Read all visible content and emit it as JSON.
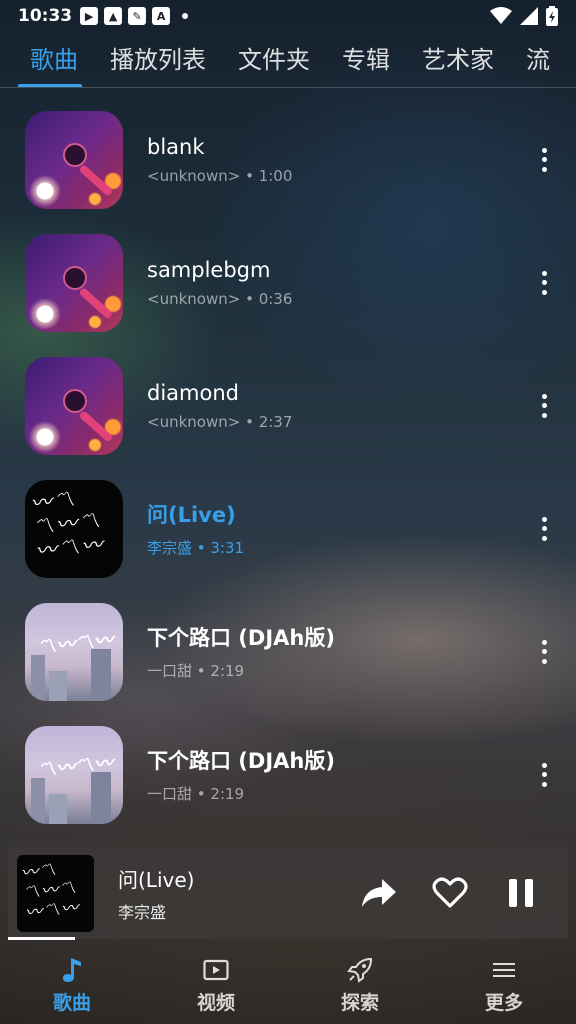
{
  "status_bar": {
    "time": "10:33"
  },
  "tabs": [
    {
      "label": "歌曲",
      "active": true
    },
    {
      "label": "播放列表",
      "active": false
    },
    {
      "label": "文件夹",
      "active": false
    },
    {
      "label": "专辑",
      "active": false
    },
    {
      "label": "艺术家",
      "active": false
    },
    {
      "label": "流",
      "active": false
    }
  ],
  "songs": [
    {
      "title": "blank",
      "artist": "<unknown>",
      "duration": "1:00",
      "cover": "mic"
    },
    {
      "title": "samplebgm",
      "artist": "<unknown>",
      "duration": "0:36",
      "cover": "mic"
    },
    {
      "title": "diamond",
      "artist": "<unknown>",
      "duration": "2:37",
      "cover": "mic"
    },
    {
      "title": "问(Live)",
      "artist": "李宗盛",
      "duration": "3:31",
      "cover": "calligraphy",
      "playing": true
    },
    {
      "title": "下个路口 (DJAh版)",
      "artist": "一口甜",
      "duration": "2:19",
      "cover": "city"
    },
    {
      "title": "下个路口 (DJAh版)",
      "artist": "一口甜",
      "duration": "2:19",
      "cover": "city"
    }
  ],
  "now_playing": {
    "title": "问(Live)",
    "artist": "李宗盛",
    "progress_fraction": 0.12
  },
  "bottom_nav": [
    {
      "label": "歌曲",
      "icon": "music-note-icon",
      "active": true
    },
    {
      "label": "视频",
      "icon": "video-icon",
      "active": false
    },
    {
      "label": "探索",
      "icon": "rocket-icon",
      "active": false
    },
    {
      "label": "更多",
      "icon": "menu-icon",
      "active": false
    }
  ],
  "colors": {
    "accent": "#3a9fe8"
  }
}
